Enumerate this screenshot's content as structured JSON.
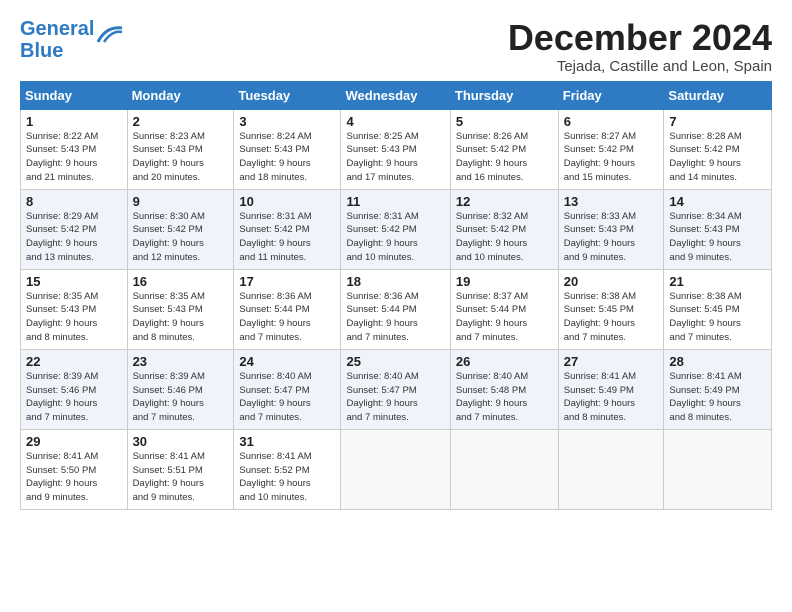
{
  "logo": {
    "line1": "General",
    "line2": "Blue"
  },
  "title": "December 2024",
  "subtitle": "Tejada, Castille and Leon, Spain",
  "headers": [
    "Sunday",
    "Monday",
    "Tuesday",
    "Wednesday",
    "Thursday",
    "Friday",
    "Saturday"
  ],
  "weeks": [
    [
      {
        "day": "1",
        "info": "Sunrise: 8:22 AM\nSunset: 5:43 PM\nDaylight: 9 hours\nand 21 minutes."
      },
      {
        "day": "2",
        "info": "Sunrise: 8:23 AM\nSunset: 5:43 PM\nDaylight: 9 hours\nand 20 minutes."
      },
      {
        "day": "3",
        "info": "Sunrise: 8:24 AM\nSunset: 5:43 PM\nDaylight: 9 hours\nand 18 minutes."
      },
      {
        "day": "4",
        "info": "Sunrise: 8:25 AM\nSunset: 5:43 PM\nDaylight: 9 hours\nand 17 minutes."
      },
      {
        "day": "5",
        "info": "Sunrise: 8:26 AM\nSunset: 5:42 PM\nDaylight: 9 hours\nand 16 minutes."
      },
      {
        "day": "6",
        "info": "Sunrise: 8:27 AM\nSunset: 5:42 PM\nDaylight: 9 hours\nand 15 minutes."
      },
      {
        "day": "7",
        "info": "Sunrise: 8:28 AM\nSunset: 5:42 PM\nDaylight: 9 hours\nand 14 minutes."
      }
    ],
    [
      {
        "day": "8",
        "info": "Sunrise: 8:29 AM\nSunset: 5:42 PM\nDaylight: 9 hours\nand 13 minutes."
      },
      {
        "day": "9",
        "info": "Sunrise: 8:30 AM\nSunset: 5:42 PM\nDaylight: 9 hours\nand 12 minutes."
      },
      {
        "day": "10",
        "info": "Sunrise: 8:31 AM\nSunset: 5:42 PM\nDaylight: 9 hours\nand 11 minutes."
      },
      {
        "day": "11",
        "info": "Sunrise: 8:31 AM\nSunset: 5:42 PM\nDaylight: 9 hours\nand 10 minutes."
      },
      {
        "day": "12",
        "info": "Sunrise: 8:32 AM\nSunset: 5:42 PM\nDaylight: 9 hours\nand 10 minutes."
      },
      {
        "day": "13",
        "info": "Sunrise: 8:33 AM\nSunset: 5:43 PM\nDaylight: 9 hours\nand 9 minutes."
      },
      {
        "day": "14",
        "info": "Sunrise: 8:34 AM\nSunset: 5:43 PM\nDaylight: 9 hours\nand 9 minutes."
      }
    ],
    [
      {
        "day": "15",
        "info": "Sunrise: 8:35 AM\nSunset: 5:43 PM\nDaylight: 9 hours\nand 8 minutes."
      },
      {
        "day": "16",
        "info": "Sunrise: 8:35 AM\nSunset: 5:43 PM\nDaylight: 9 hours\nand 8 minutes."
      },
      {
        "day": "17",
        "info": "Sunrise: 8:36 AM\nSunset: 5:44 PM\nDaylight: 9 hours\nand 7 minutes."
      },
      {
        "day": "18",
        "info": "Sunrise: 8:36 AM\nSunset: 5:44 PM\nDaylight: 9 hours\nand 7 minutes."
      },
      {
        "day": "19",
        "info": "Sunrise: 8:37 AM\nSunset: 5:44 PM\nDaylight: 9 hours\nand 7 minutes."
      },
      {
        "day": "20",
        "info": "Sunrise: 8:38 AM\nSunset: 5:45 PM\nDaylight: 9 hours\nand 7 minutes."
      },
      {
        "day": "21",
        "info": "Sunrise: 8:38 AM\nSunset: 5:45 PM\nDaylight: 9 hours\nand 7 minutes."
      }
    ],
    [
      {
        "day": "22",
        "info": "Sunrise: 8:39 AM\nSunset: 5:46 PM\nDaylight: 9 hours\nand 7 minutes."
      },
      {
        "day": "23",
        "info": "Sunrise: 8:39 AM\nSunset: 5:46 PM\nDaylight: 9 hours\nand 7 minutes."
      },
      {
        "day": "24",
        "info": "Sunrise: 8:40 AM\nSunset: 5:47 PM\nDaylight: 9 hours\nand 7 minutes."
      },
      {
        "day": "25",
        "info": "Sunrise: 8:40 AM\nSunset: 5:47 PM\nDaylight: 9 hours\nand 7 minutes."
      },
      {
        "day": "26",
        "info": "Sunrise: 8:40 AM\nSunset: 5:48 PM\nDaylight: 9 hours\nand 7 minutes."
      },
      {
        "day": "27",
        "info": "Sunrise: 8:41 AM\nSunset: 5:49 PM\nDaylight: 9 hours\nand 8 minutes."
      },
      {
        "day": "28",
        "info": "Sunrise: 8:41 AM\nSunset: 5:49 PM\nDaylight: 9 hours\nand 8 minutes."
      }
    ],
    [
      {
        "day": "29",
        "info": "Sunrise: 8:41 AM\nSunset: 5:50 PM\nDaylight: 9 hours\nand 9 minutes."
      },
      {
        "day": "30",
        "info": "Sunrise: 8:41 AM\nSunset: 5:51 PM\nDaylight: 9 hours\nand 9 minutes."
      },
      {
        "day": "31",
        "info": "Sunrise: 8:41 AM\nSunset: 5:52 PM\nDaylight: 9 hours\nand 10 minutes."
      },
      {
        "day": "",
        "info": ""
      },
      {
        "day": "",
        "info": ""
      },
      {
        "day": "",
        "info": ""
      },
      {
        "day": "",
        "info": ""
      }
    ]
  ]
}
